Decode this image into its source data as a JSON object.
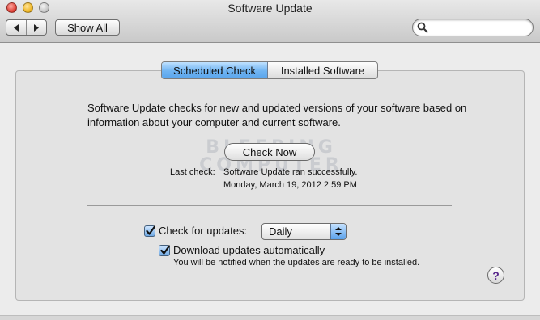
{
  "window": {
    "title": "Software Update"
  },
  "toolbar": {
    "back_icon": "back-arrow-icon",
    "forward_icon": "forward-arrow-icon",
    "show_all_label": "Show All",
    "search_value": ""
  },
  "tabs": [
    {
      "label": "Scheduled Check",
      "selected": true
    },
    {
      "label": "Installed Software",
      "selected": false
    }
  ],
  "content": {
    "description": "Software Update checks for new and updated versions of your software based on information about your computer and current software.",
    "check_now_label": "Check Now",
    "last_check_label": "Last check:",
    "last_check_status": "Software Update ran successfully.",
    "last_check_date": "Monday, March 19, 2012 2:59 PM",
    "watermark_line1": "BLEEPING",
    "watermark_line2": "COMPUTER"
  },
  "settings": {
    "check_for_updates": {
      "label": "Check for updates:",
      "checked": true
    },
    "frequency": {
      "value": "Daily"
    },
    "download_automatically": {
      "label": "Download updates automatically",
      "checked": true
    },
    "notify_text": "You will be notified when the updates are ready to be installed."
  },
  "help": {
    "label": "?"
  },
  "colors": {
    "accent": "#5aa5ec",
    "help_glyph": "#5b2a8e"
  }
}
